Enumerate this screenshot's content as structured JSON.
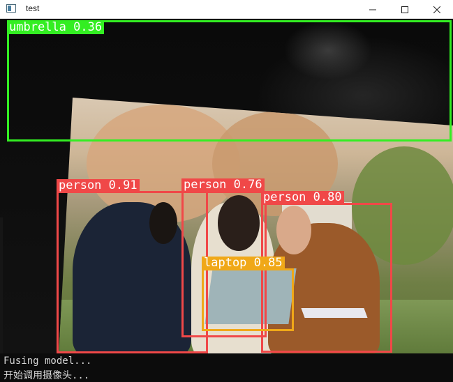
{
  "window": {
    "title": "test",
    "icons": {
      "app": "window-app-icon",
      "minimize": "minimize-icon",
      "maximize": "maximize-icon",
      "close": "close-icon"
    }
  },
  "detections": [
    {
      "label": "umbrella 0.36",
      "color": "#33ee22"
    },
    {
      "label": "person 0.91",
      "color": "#f04848"
    },
    {
      "label": "person 0.76",
      "color": "#f04848"
    },
    {
      "label": "person 0.80",
      "color": "#f04848"
    },
    {
      "label": "laptop 0.85",
      "color": "#f0a818"
    }
  ],
  "console": {
    "lines": [
      "Fusing model...",
      "开始调用摄像头..."
    ]
  }
}
